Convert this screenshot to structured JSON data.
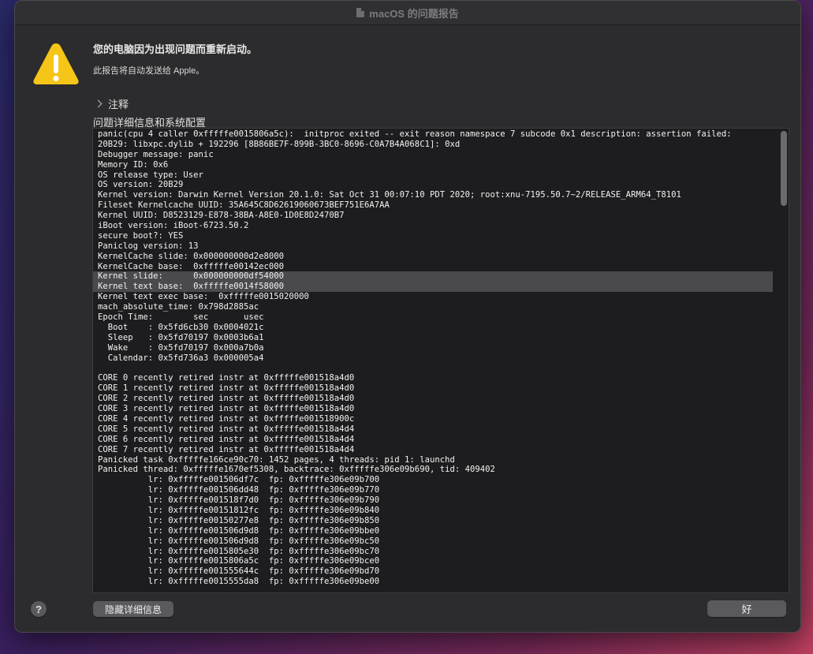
{
  "window": {
    "title": "macOS 的问题报告",
    "title_icon": "document-icon"
  },
  "header": {
    "heading": "您的电脑因为出现问题而重新启动。",
    "subtext": "此报告将自动发送给 Apple。",
    "icon": "warning-icon"
  },
  "comments": {
    "label": "注释",
    "icon": "chevron-right-icon"
  },
  "details": {
    "label": "问题详细信息和系统配置",
    "highlighted_lines": [
      14,
      15
    ],
    "lines": [
      "panic(cpu 4 caller 0xfffffe0015806a5c):  initproc exited -- exit reason namespace 7 subcode 0x1 description: assertion failed:",
      "20B29: libxpc.dylib + 192296 [8B86BE7F-899B-3BC0-8696-C0A7B4A068C1]: 0xd",
      "Debugger message: panic",
      "Memory ID: 0x6",
      "OS release type: User",
      "OS version: 20B29",
      "Kernel version: Darwin Kernel Version 20.1.0: Sat Oct 31 00:07:10 PDT 2020; root:xnu-7195.50.7~2/RELEASE_ARM64_T8101",
      "Fileset Kernelcache UUID: 35A645C8D62619060673BEF751E6A7AA",
      "Kernel UUID: D8523129-E878-38BA-A8E0-1D0E8D2470B7",
      "iBoot version: iBoot-6723.50.2",
      "secure boot?: YES",
      "Paniclog version: 13",
      "KernelCache slide: 0x000000000d2e8000",
      "KernelCache base:  0xfffffe00142ec000",
      "Kernel slide:      0x000000000df54000",
      "Kernel text base:  0xfffffe0014f58000",
      "Kernel text exec base:  0xfffffe0015020000",
      "mach_absolute_time: 0x798d2885ac",
      "Epoch Time:        sec       usec",
      "  Boot    : 0x5fd6cb30 0x0004021c",
      "  Sleep   : 0x5fd70197 0x0003b6a1",
      "  Wake    : 0x5fd70197 0x000a7b0a",
      "  Calendar: 0x5fd736a3 0x000005a4",
      "",
      "CORE 0 recently retired instr at 0xfffffe001518a4d0",
      "CORE 1 recently retired instr at 0xfffffe001518a4d0",
      "CORE 2 recently retired instr at 0xfffffe001518a4d0",
      "CORE 3 recently retired instr at 0xfffffe001518a4d0",
      "CORE 4 recently retired instr at 0xfffffe001518900c",
      "CORE 5 recently retired instr at 0xfffffe001518a4d4",
      "CORE 6 recently retired instr at 0xfffffe001518a4d4",
      "CORE 7 recently retired instr at 0xfffffe001518a4d4",
      "Panicked task 0xfffffe166ce90c70: 1452 pages, 4 threads: pid 1: launchd",
      "Panicked thread: 0xfffffe1670ef5308, backtrace: 0xfffffe306e09b690, tid: 409402",
      "          lr: 0xfffffe001506df7c  fp: 0xfffffe306e09b700",
      "          lr: 0xfffffe001506dd48  fp: 0xfffffe306e09b770",
      "          lr: 0xfffffe001518f7d0  fp: 0xfffffe306e09b790",
      "          lr: 0xfffffe00151812fc  fp: 0xfffffe306e09b840",
      "          lr: 0xfffffe00150277e8  fp: 0xfffffe306e09b850",
      "          lr: 0xfffffe001506d9d8  fp: 0xfffffe306e09bbe0",
      "          lr: 0xfffffe001506d9d8  fp: 0xfffffe306e09bc50",
      "          lr: 0xfffffe0015805e30  fp: 0xfffffe306e09bc70",
      "          lr: 0xfffffe0015806a5c  fp: 0xfffffe306e09bce0",
      "          lr: 0xfffffe001555644c  fp: 0xfffffe306e09bd70",
      "          lr: 0xfffffe0015555da8  fp: 0xfffffe306e09be00"
    ]
  },
  "footer": {
    "help_label": "?",
    "hide_details_label": "隐藏详细信息",
    "ok_label": "好"
  },
  "colors": {
    "window_bg": "#2c2b2d",
    "report_bg": "#1d1d1f",
    "selection": "#4a494c",
    "warning_yellow": "#f5c518"
  }
}
